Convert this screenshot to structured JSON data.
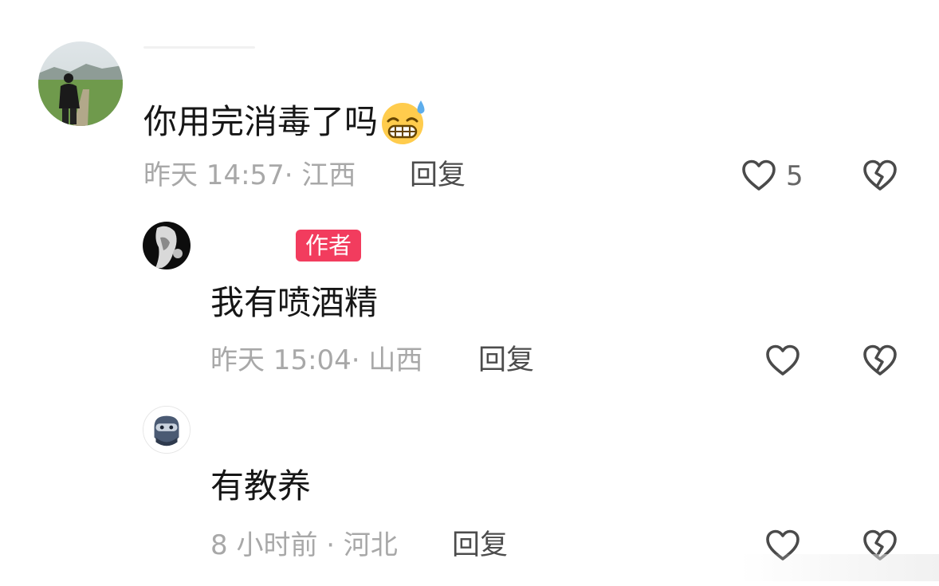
{
  "comments": [
    {
      "text": "你用完消毒了吗",
      "emoji": "grimacing-sweat-emoji",
      "meta": "昨天 14:57· 江西",
      "reply": "回复",
      "likes": "5"
    },
    {
      "badge": "作者",
      "text": "我有喷酒精",
      "meta": "昨天 15:04· 山西",
      "reply": "回复"
    },
    {
      "text": "有教养",
      "meta": "8 小时前 · 河北",
      "reply": "回复"
    }
  ],
  "colors": {
    "badge": "#f23c5e",
    "meta_text": "#a8a8a8",
    "reply_text": "#4c4c4c",
    "icon_stroke": "#4a4a4a"
  }
}
